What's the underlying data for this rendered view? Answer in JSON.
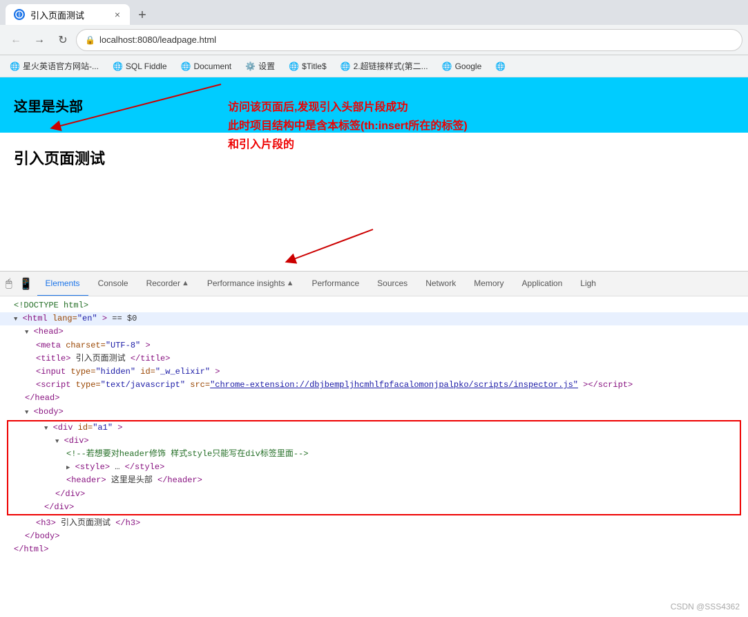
{
  "browser": {
    "tab_title": "引入页面测试",
    "tab_close": "×",
    "tab_new": "+",
    "back_btn": "←",
    "forward_btn": "→",
    "refresh_btn": "↻",
    "url": "localhost:8080/leadpage.html",
    "bookmarks": [
      {
        "label": "星火英语官方网站-...",
        "icon": "globe"
      },
      {
        "label": "SQL Fiddle",
        "icon": "globe"
      },
      {
        "label": "Document",
        "icon": "globe"
      },
      {
        "label": "设置",
        "icon": "gear"
      },
      {
        "label": "$Title$",
        "icon": "globe"
      },
      {
        "label": "2.超链接样式(第二...",
        "icon": "globe"
      },
      {
        "label": "Google",
        "icon": "globe"
      },
      {
        "label": "",
        "icon": "globe"
      }
    ]
  },
  "page": {
    "header_text": "这里是头部",
    "h3_text": "引入页面测试"
  },
  "annotation": {
    "text_line1": "访问该页面后,发现引入头部片段成功",
    "text_line2": "此时项目结构中是含本标签(th:insert所在的标签)",
    "text_line3": "和引入片段的"
  },
  "devtools": {
    "tabs": [
      {
        "label": "Elements",
        "active": true
      },
      {
        "label": "Console",
        "active": false
      },
      {
        "label": "Recorder",
        "active": false,
        "warning": "▲"
      },
      {
        "label": "Performance insights",
        "active": false,
        "warning": "▲"
      },
      {
        "label": "Performance",
        "active": false
      },
      {
        "label": "Sources",
        "active": false
      },
      {
        "label": "Network",
        "active": false
      },
      {
        "label": "Memory",
        "active": false
      },
      {
        "label": "Application",
        "active": false
      },
      {
        "label": "Ligh",
        "active": false
      }
    ],
    "code_lines": [
      {
        "indent": 0,
        "content": "<!DOCTYPE html>",
        "type": "comment_doctype"
      },
      {
        "indent": 0,
        "content": "<html lang=\"en\">  == $0",
        "selected": true
      },
      {
        "indent": 1,
        "content": "<head>"
      },
      {
        "indent": 2,
        "content": "<meta charset=\"UTF-8\">"
      },
      {
        "indent": 2,
        "content": "<title>引入页面测试</title>"
      },
      {
        "indent": 2,
        "content": "<input type=\"hidden\" id=\"_w_elixir\">"
      },
      {
        "indent": 2,
        "content": "<script type=\"text/javascript\" src=\"chrome-extension://dbjbempljhcmhlfpfacalomonjpalpko/scripts/inspector.js\"><\\/script>"
      },
      {
        "indent": 1,
        "content": "</head>"
      },
      {
        "indent": 1,
        "content": "<body>"
      },
      {
        "indent": 2,
        "content": "<div id=\"a1\">",
        "highlighted_start": true
      },
      {
        "indent": 3,
        "content": "<div>"
      },
      {
        "indent": 4,
        "content": "<!--若想要对header修饰 样式style只能写在div标签里面-->"
      },
      {
        "indent": 4,
        "content": "<style>…</style>"
      },
      {
        "indent": 4,
        "content": "<header> 这里是头部 </header>"
      },
      {
        "indent": 3,
        "content": "</div>"
      },
      {
        "indent": 2,
        "content": "</div>",
        "highlighted_end": true
      },
      {
        "indent": 2,
        "content": "<h3>引入页面测试</h3>"
      },
      {
        "indent": 1,
        "content": "</body>"
      },
      {
        "indent": 0,
        "content": "</html>"
      }
    ]
  },
  "watermark": "CSDN @SSS4362"
}
